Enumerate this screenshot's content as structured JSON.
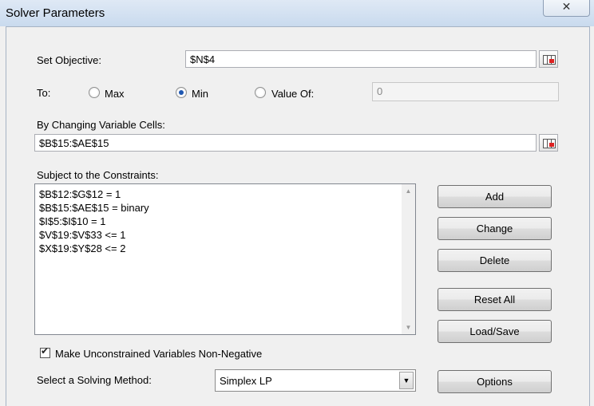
{
  "window": {
    "title": "Solver Parameters",
    "close_glyph": "✕"
  },
  "objective": {
    "label": "Set Objective:",
    "value": "$N$4"
  },
  "to": {
    "label": "To:",
    "options": [
      {
        "label": "Max",
        "selected": false
      },
      {
        "label": "Min",
        "selected": true
      },
      {
        "label": "Value Of:",
        "selected": false
      }
    ],
    "value_of": "0"
  },
  "changing": {
    "label": "By Changing Variable Cells:",
    "value": "$B$15:$AE$15"
  },
  "constraints": {
    "label": "Subject to the Constraints:",
    "items": [
      "$B$12:$G$12 = 1",
      "$B$15:$AE$15 = binary",
      "$I$5:$I$10 = 1",
      "$V$19:$V$33 <= 1",
      "$X$19:$Y$28 <= 2"
    ]
  },
  "buttons": {
    "add": "Add",
    "change": "Change",
    "delete": "Delete",
    "reset_all": "Reset All",
    "load_save": "Load/Save",
    "options": "Options"
  },
  "nonneg": {
    "label": "Make Unconstrained Variables Non-Negative",
    "checked": true
  },
  "method": {
    "label": "Select a Solving Method:",
    "value": "Simplex LP"
  }
}
